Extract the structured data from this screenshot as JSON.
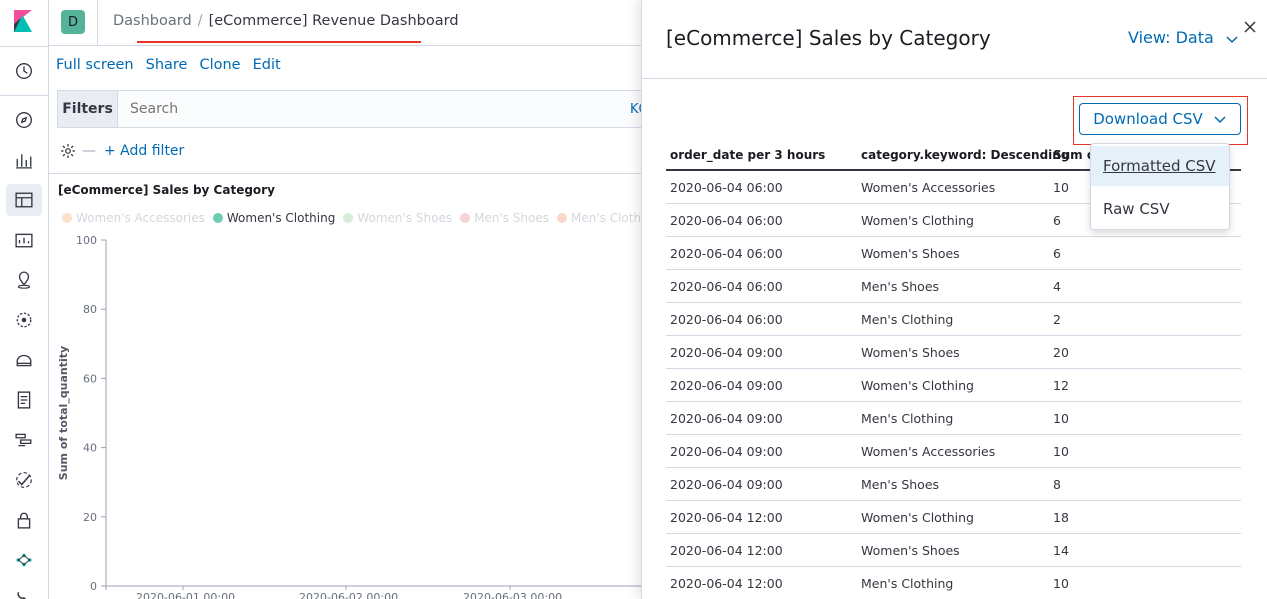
{
  "header": {
    "space_initial": "D",
    "breadcrumbs": [
      "Dashboard",
      "[eCommerce] Revenue Dashboard"
    ],
    "separator": "/"
  },
  "toolbar": {
    "links": [
      "Full screen",
      "Share",
      "Clone",
      "Edit"
    ]
  },
  "filterbar": {
    "filters_label": "Filters",
    "search_placeholder": "Search",
    "kql_label": "KQL",
    "add_filter": "+ Add filter",
    "dash": "—"
  },
  "panel": {
    "title": "[eCommerce] Sales by Category",
    "legend": [
      {
        "label": "Women's Accessories",
        "color": "#fbe2c9",
        "active": false
      },
      {
        "label": "Women's Clothing",
        "color": "#6dccb1",
        "active": true
      },
      {
        "label": "Women's Shoes",
        "color": "#d9ecd8",
        "active": false
      },
      {
        "label": "Men's Shoes",
        "color": "#f7d3d3",
        "active": false
      },
      {
        "label": "Men's Clothing",
        "color": "#f9d6c8",
        "active": false
      },
      {
        "label": "",
        "color": "#d8d5e8",
        "active": false
      }
    ]
  },
  "chart_data": {
    "type": "area",
    "ylabel": "Sum of total_quantity",
    "ylim": [
      0,
      100
    ],
    "yticks": [
      0,
      20,
      40,
      60,
      80,
      100
    ],
    "xticks": [
      "2020-06-01 00:00",
      "2020-06-02 00:00",
      "2020-06-03 00:00"
    ],
    "grid": false
  },
  "flyout": {
    "title": "[eCommerce] Sales by Category",
    "view_label": "View: Data",
    "download_label": "Download CSV",
    "menu": [
      "Formatted CSV",
      "Raw CSV"
    ],
    "columns": [
      "order_date per 3 hours",
      "category.keyword: Descending",
      "Sum of total_quantity"
    ],
    "rows": [
      [
        "2020-06-04 06:00",
        "Women's Accessories",
        "10"
      ],
      [
        "2020-06-04 06:00",
        "Women's Clothing",
        "6"
      ],
      [
        "2020-06-04 06:00",
        "Women's Shoes",
        "6"
      ],
      [
        "2020-06-04 06:00",
        "Men's Shoes",
        "4"
      ],
      [
        "2020-06-04 06:00",
        "Men's Clothing",
        "2"
      ],
      [
        "2020-06-04 09:00",
        "Women's Shoes",
        "20"
      ],
      [
        "2020-06-04 09:00",
        "Women's Clothing",
        "12"
      ],
      [
        "2020-06-04 09:00",
        "Men's Clothing",
        "10"
      ],
      [
        "2020-06-04 09:00",
        "Women's Accessories",
        "10"
      ],
      [
        "2020-06-04 09:00",
        "Men's Shoes",
        "8"
      ],
      [
        "2020-06-04 12:00",
        "Women's Clothing",
        "18"
      ],
      [
        "2020-06-04 12:00",
        "Women's Shoes",
        "14"
      ],
      [
        "2020-06-04 12:00",
        "Men's Clothing",
        "10"
      ]
    ]
  }
}
